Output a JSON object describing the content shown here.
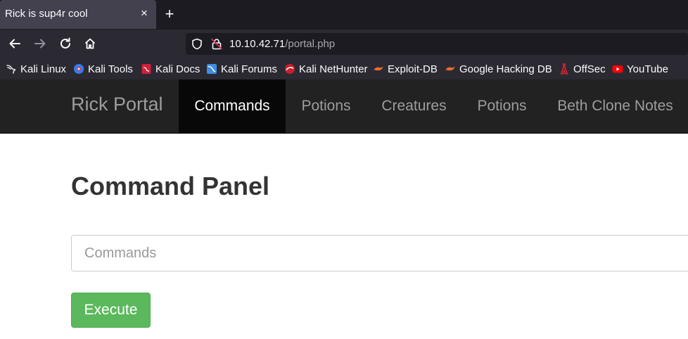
{
  "browser": {
    "tab": {
      "title": "Rick is sup4r cool",
      "close_glyph": "×"
    },
    "new_tab_glyph": "+",
    "url": {
      "host": "10.10.42.71",
      "path": "/portal.php"
    },
    "bookmarks": [
      {
        "label": "Kali Linux",
        "icon": "kali-dragon-icon"
      },
      {
        "label": "Kali Tools",
        "icon": "kali-tools-icon"
      },
      {
        "label": "Kali Docs",
        "icon": "kali-docs-icon"
      },
      {
        "label": "Kali Forums",
        "icon": "kali-forums-icon"
      },
      {
        "label": "Kali NetHunter",
        "icon": "nethunter-icon"
      },
      {
        "label": "Exploit-DB",
        "icon": "exploit-db-icon"
      },
      {
        "label": "Google Hacking DB",
        "icon": "ghdb-icon"
      },
      {
        "label": "OffSec",
        "icon": "offsec-icon"
      },
      {
        "label": "YouTube",
        "icon": "youtube-icon"
      }
    ]
  },
  "site": {
    "brand": "Rick Portal",
    "nav": [
      {
        "label": "Commands",
        "active": true
      },
      {
        "label": "Potions",
        "active": false
      },
      {
        "label": "Creatures",
        "active": false
      },
      {
        "label": "Potions",
        "active": false
      },
      {
        "label": "Beth Clone Notes",
        "active": false
      }
    ]
  },
  "main": {
    "title": "Command Panel",
    "command_input": {
      "placeholder": "Commands",
      "value": ""
    },
    "execute_label": "Execute"
  },
  "colors": {
    "chrome_dark": "#1c1b22",
    "chrome_mid": "#2b2a33",
    "tab_active": "#42414d",
    "site_nav_bg": "#222222",
    "site_nav_active": "#080808",
    "success_button": "#5cb85c"
  }
}
